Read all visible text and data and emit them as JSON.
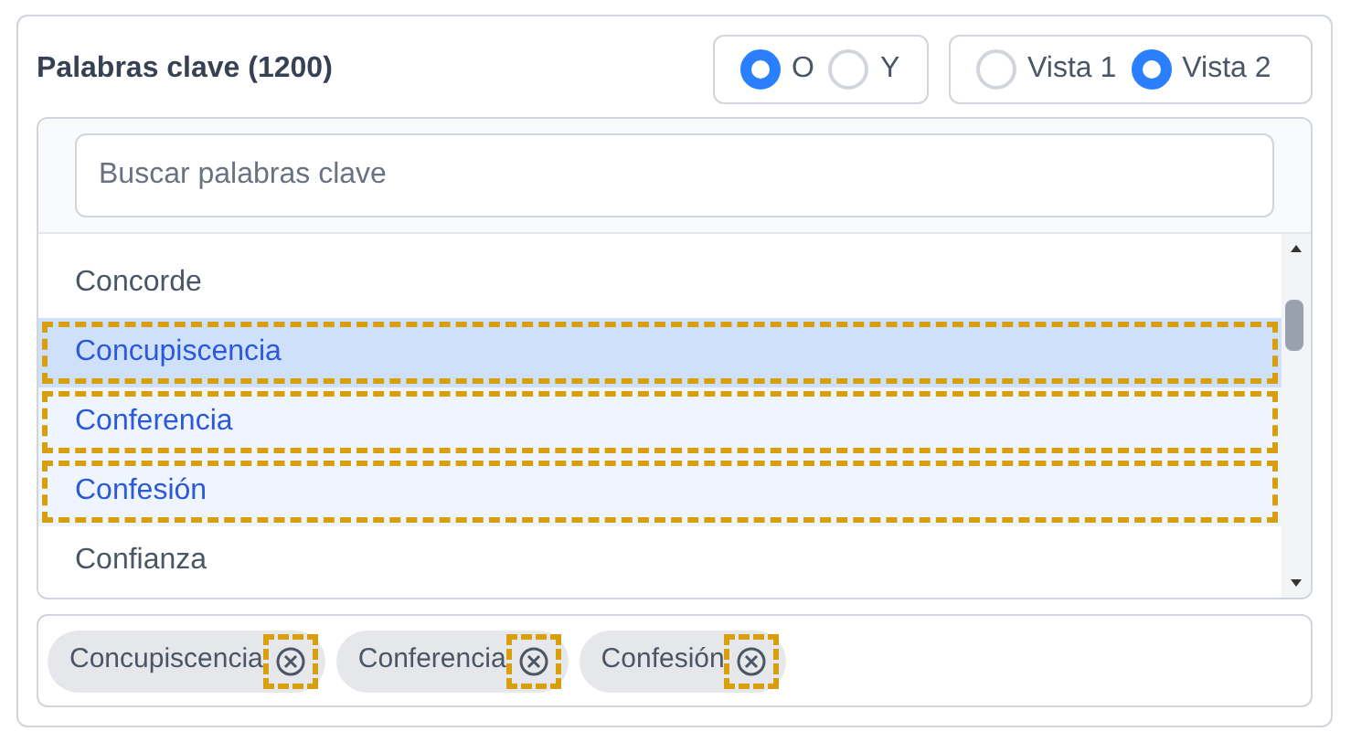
{
  "title": "Palabras clave (1200)",
  "match_mode": [
    {
      "label": "O",
      "selected": true
    },
    {
      "label": "Y",
      "selected": false
    }
  ],
  "view_mode": [
    {
      "label": "Vista 1",
      "selected": false
    },
    {
      "label": "Vista 2",
      "selected": true
    }
  ],
  "search": {
    "placeholder": "Buscar palabras clave"
  },
  "keywords": [
    {
      "label": "Concorde",
      "selected": false,
      "active": false,
      "outlined": false
    },
    {
      "label": "Concupiscencia",
      "selected": true,
      "active": true,
      "outlined": true
    },
    {
      "label": "Conferencia",
      "selected": true,
      "active": false,
      "outlined": true
    },
    {
      "label": "Confesión",
      "selected": true,
      "active": false,
      "outlined": true
    },
    {
      "label": "Confianza",
      "selected": false,
      "active": false,
      "outlined": false
    }
  ],
  "chips": [
    {
      "label": "Concupiscencia",
      "outlined": true
    },
    {
      "label": "Conferencia",
      "outlined": true
    },
    {
      "label": "Confesión",
      "outlined": true
    }
  ]
}
